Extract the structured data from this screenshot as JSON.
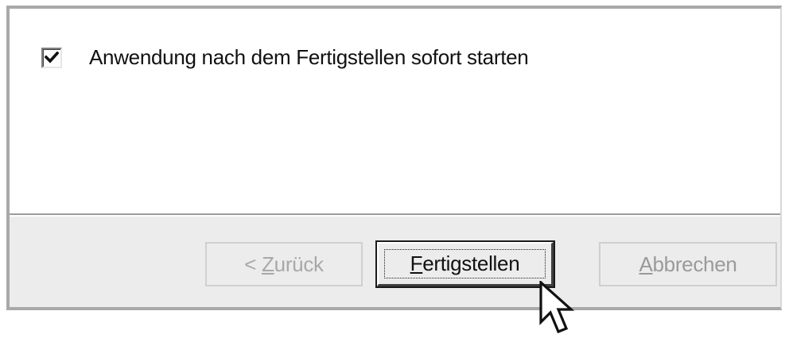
{
  "dialog": {
    "option": {
      "label": "Anwendung nach dem Fertigstellen sofort starten",
      "checked": true
    },
    "buttons": {
      "back": {
        "prefix": "< ",
        "mnemonic": "Z",
        "rest": "urück",
        "enabled": false
      },
      "finish": {
        "prefix": "",
        "mnemonic": "F",
        "rest": "ertigstellen",
        "enabled": true,
        "focused": true
      },
      "cancel": {
        "prefix": "",
        "mnemonic": "A",
        "rest": "bbrechen",
        "enabled": false
      }
    }
  },
  "icons": {
    "checkmark": "check-icon",
    "pointer": "mouse-pointer-icon"
  },
  "colors": {
    "dialog_background": "#ececec",
    "content_background": "#ffffff",
    "disabled_text": "#a8a8a8",
    "text": "#111111"
  }
}
